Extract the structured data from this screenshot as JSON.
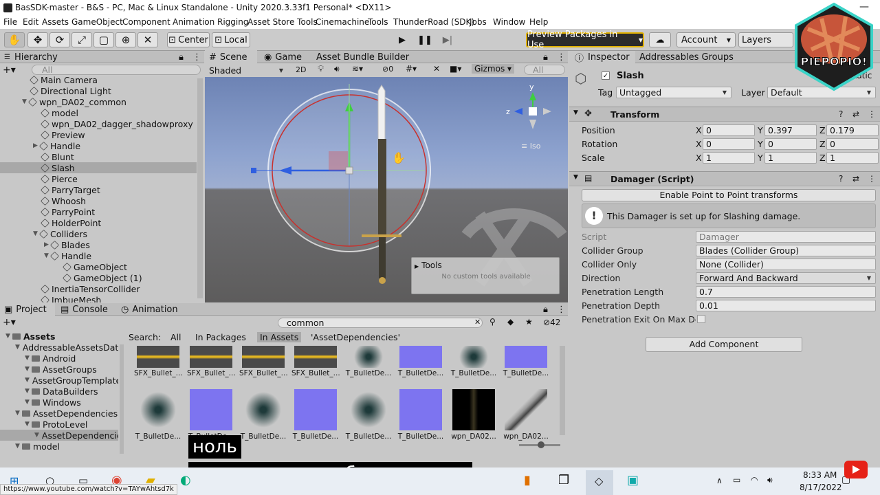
{
  "window": {
    "title": "BasSDK-master - B&S - PC, Mac & Linux Standalone - Unity 2020.3.33f1 Personal* <DX11>"
  },
  "menu": [
    "File",
    "Edit",
    "Assets",
    "GameObject",
    "Component",
    "Animation Rigging",
    "Asset Store Tools",
    "Cinemachine",
    "Tools",
    "ThunderRoad (SDK)",
    "Jobs",
    "Window",
    "Help"
  ],
  "toolbar": {
    "pivot": "Center",
    "space": "Local",
    "preview_packages": "Preview Packages in Use",
    "account": "Account",
    "layers": "Layers"
  },
  "hierarchy": {
    "tab": "Hierarchy",
    "search_placeholder": "All",
    "items": [
      {
        "label": "Main Camera",
        "indent": 1
      },
      {
        "label": "Directional Light",
        "indent": 1
      },
      {
        "label": "wpn_DA02_common",
        "indent": 1,
        "expanded": true
      },
      {
        "label": "model",
        "indent": 2
      },
      {
        "label": "wpn_DA02_dagger_shadowproxy",
        "indent": 2
      },
      {
        "label": "Preview",
        "indent": 2
      },
      {
        "label": "Handle",
        "indent": 2,
        "collapsed": true
      },
      {
        "label": "Blunt",
        "indent": 2
      },
      {
        "label": "Slash",
        "indent": 2,
        "selected": true
      },
      {
        "label": "Pierce",
        "indent": 2
      },
      {
        "label": "ParryTarget",
        "indent": 2
      },
      {
        "label": "Whoosh",
        "indent": 2
      },
      {
        "label": "ParryPoint",
        "indent": 2
      },
      {
        "label": "HolderPoint",
        "indent": 2
      },
      {
        "label": "Colliders",
        "indent": 2,
        "expanded": true
      },
      {
        "label": "Blades",
        "indent": 3,
        "collapsed": true
      },
      {
        "label": "Handle",
        "indent": 3,
        "expanded": true
      },
      {
        "label": "GameObject",
        "indent": 4
      },
      {
        "label": "GameObject (1)",
        "indent": 4
      },
      {
        "label": "InertiaTensorCollider",
        "indent": 2
      },
      {
        "label": "ImbueMesh",
        "indent": 2
      }
    ]
  },
  "scene": {
    "tabs": [
      "Scene",
      "Game",
      "Asset Bundle Builder"
    ],
    "shading": "Shaded",
    "mode_2d": "2D",
    "hidden_count": "0",
    "gizmos": "Gizmos",
    "search_placeholder": "All",
    "iso_label": "Iso",
    "tools_panel_title": "Tools",
    "tools_panel_text": "No custom tools available"
  },
  "inspector": {
    "tabs": [
      "Inspector",
      "Addressables Groups"
    ],
    "object_name": "Slash",
    "static_label": "Static",
    "tag_label": "Tag",
    "tag_value": "Untagged",
    "layer_label": "Layer",
    "layer_value": "Default",
    "transform": {
      "title": "Transform",
      "rows": [
        {
          "label": "Position",
          "x": "0",
          "y": "0.397",
          "z": "0.179"
        },
        {
          "label": "Rotation",
          "x": "0",
          "y": "0",
          "z": "0"
        },
        {
          "label": "Scale",
          "x": "1",
          "y": "1",
          "z": "1"
        }
      ]
    },
    "damager": {
      "title": "Damager (Script)",
      "button": "Enable Point to Point transforms",
      "info": "This Damager is set up for Slashing damage.",
      "props": [
        {
          "label": "Script",
          "value": "Damager"
        },
        {
          "label": "Collider Group",
          "value": "Blades (Collider Group)"
        },
        {
          "label": "Collider Only",
          "value": "None (Collider)"
        },
        {
          "label": "Direction",
          "value": "Forward And Backward"
        },
        {
          "label": "Penetration Length",
          "value": "0.7"
        },
        {
          "label": "Penetration Depth",
          "value": "0.01"
        },
        {
          "label": "Penetration Exit On Max Depth",
          "value": ""
        }
      ]
    },
    "add_component": "Add Component"
  },
  "project": {
    "tabs": [
      "Project",
      "Console",
      "Animation"
    ],
    "search_value": "common",
    "count": "42",
    "search_label": "Search:",
    "scopes": [
      "All",
      "In Packages",
      "In Assets",
      "'AssetDependencies'"
    ],
    "tree": [
      {
        "label": "Assets",
        "indent": 0,
        "bold": true
      },
      {
        "label": "AddressableAssetsData",
        "indent": 1
      },
      {
        "label": "Android",
        "indent": 2
      },
      {
        "label": "AssetGroups",
        "indent": 2
      },
      {
        "label": "AssetGroupTemplates",
        "indent": 2
      },
      {
        "label": "DataBuilders",
        "indent": 2
      },
      {
        "label": "Windows",
        "indent": 2
      },
      {
        "label": "AssetDependencies",
        "indent": 1
      },
      {
        "label": "ProtoLevel",
        "indent": 2
      },
      {
        "label": "AssetDependencies",
        "indent": 3,
        "selected": true
      },
      {
        "label": "model",
        "indent": 1
      }
    ],
    "assets_row1": [
      "SFX_Bullet_...",
      "SFX_Bullet_...",
      "SFX_Bullet_...",
      "SFX_Bullet_...",
      "T_BulletDe...",
      "T_BulletDe...",
      "T_BulletDe...",
      "T_BulletDe..."
    ],
    "assets_row2": [
      "T_BulletDe...",
      "T_BulletDe...",
      "T_BulletDe...",
      "T_BulletDe...",
      "T_BulletDe...",
      "T_BulletDe...",
      "wpn_DA02...",
      "wpn_DA02..."
    ]
  },
  "overlay": {
    "channel_logo": "PIEPOPIO!",
    "subtitle_line1": "ноль",
    "subtitle_line2": "и семь, должно быть хорошо",
    "status_url": "https://www.youtube.com/watch?v=TAYwAhtsd7k"
  },
  "taskbar": {
    "time": "8:33 AM",
    "date": "8/17/2022"
  }
}
